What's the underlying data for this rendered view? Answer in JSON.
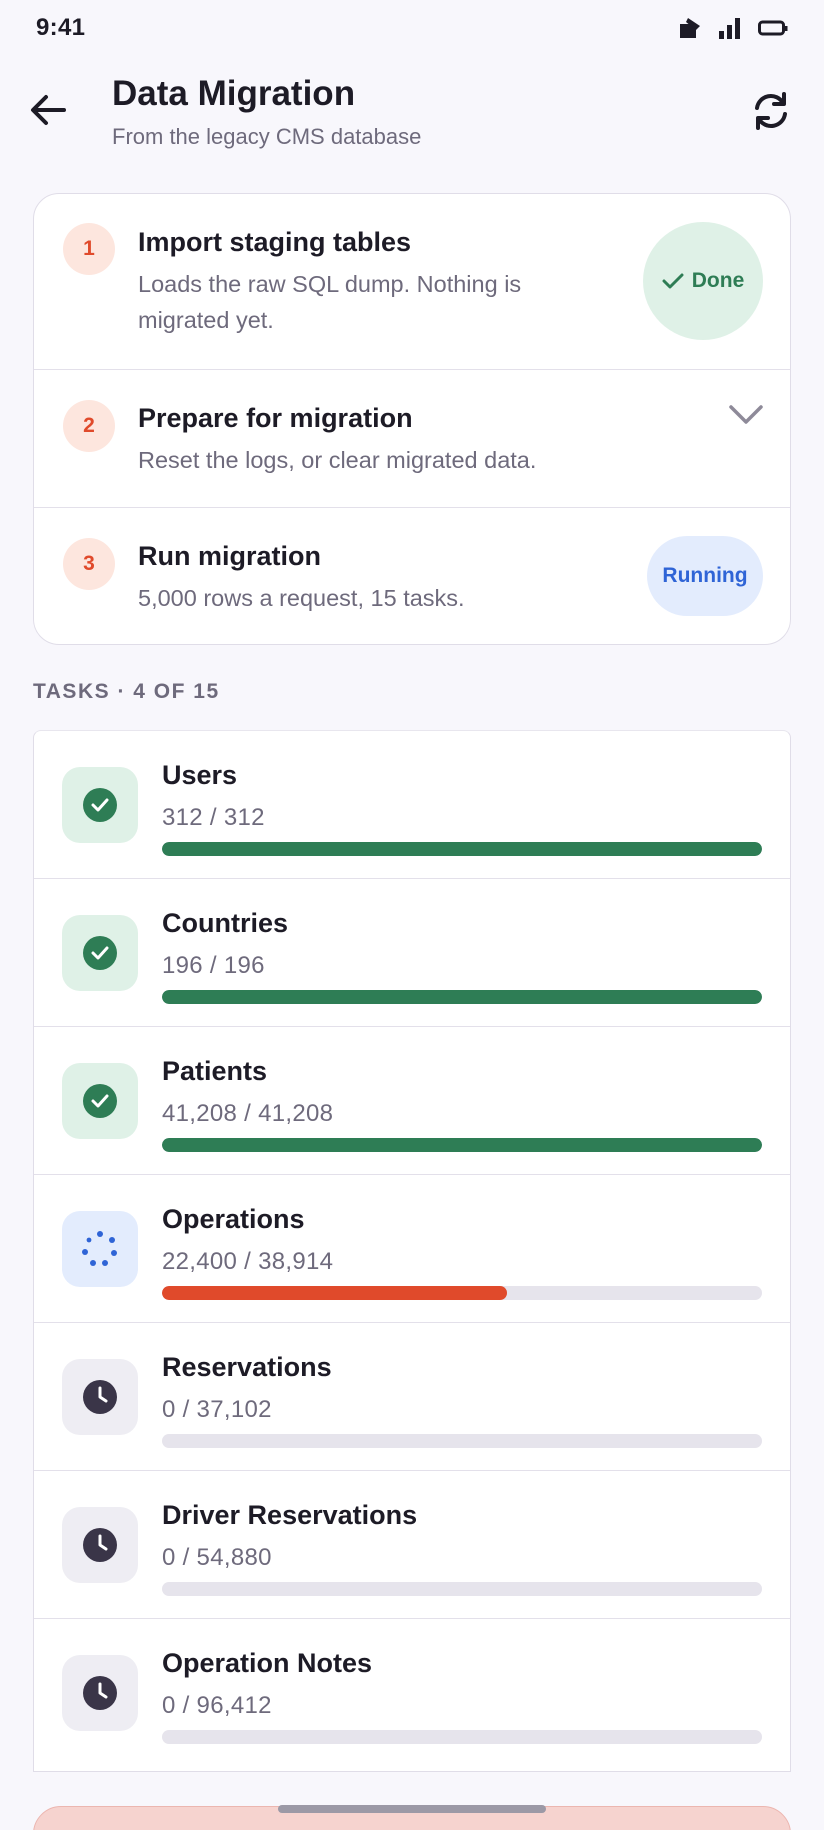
{
  "status_bar": {
    "time": "9:41"
  },
  "header": {
    "title": "Data Migration",
    "subtitle": "From the legacy CMS database"
  },
  "steps": [
    {
      "number": "1",
      "title": "Import staging tables",
      "description": "Loads the raw SQL dump. Nothing is migrated yet.",
      "badge": "Done"
    },
    {
      "number": "2",
      "title": "Prepare for migration",
      "description": "Reset the logs, or clear migrated data."
    },
    {
      "number": "3",
      "title": "Run migration",
      "description": "5,000 rows a request, 15 tasks.",
      "badge": "Running"
    }
  ],
  "tasks_label": "TASKS · 4 OF 15",
  "tasks": [
    {
      "name": "Users",
      "count": "312 / 312",
      "progress": 1.0,
      "state": "done"
    },
    {
      "name": "Countries",
      "count": "196 / 196",
      "progress": 1.0,
      "state": "done"
    },
    {
      "name": "Patients",
      "count": "41,208 / 41,208",
      "progress": 1.0,
      "state": "done"
    },
    {
      "name": "Operations",
      "count": "22,400 / 38,914",
      "progress": 0.5756,
      "state": "running"
    },
    {
      "name": "Reservations",
      "count": "0 / 37,102",
      "progress": 0,
      "state": "pending"
    },
    {
      "name": "Driver Reservations",
      "count": "0 / 54,880",
      "progress": 0,
      "state": "pending"
    },
    {
      "name": "Operation Notes",
      "count": "0 / 96,412",
      "progress": 0,
      "state": "pending"
    }
  ],
  "colors": {
    "done": "#2e7d55",
    "running": "#e04a2b",
    "accent_blue": "#2f64d6",
    "track": "#e6e4ec"
  }
}
